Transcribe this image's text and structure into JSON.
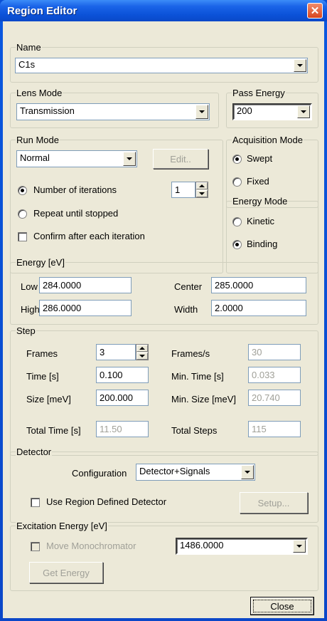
{
  "window": {
    "title": "Region Editor",
    "close_glyph": "✕"
  },
  "name_group": {
    "label": "Name",
    "value": "C1s"
  },
  "lens_mode": {
    "label": "Lens Mode",
    "value": "Transmission"
  },
  "pass_energy": {
    "label": "Pass Energy",
    "value": "200"
  },
  "run_mode": {
    "label": "Run Mode",
    "value": "Normal",
    "edit_button": "Edit..",
    "iterations_label": "Number of iterations",
    "iterations_value": "1",
    "repeat_label": "Repeat until stopped",
    "confirm_label": "Confirm after each iteration"
  },
  "acquisition_mode": {
    "label": "Acquisition Mode",
    "swept": "Swept",
    "fixed": "Fixed",
    "selected": "Swept"
  },
  "energy_mode": {
    "label": "Energy Mode",
    "kinetic": "Kinetic",
    "binding": "Binding",
    "selected": "Binding"
  },
  "energy": {
    "label": "Energy  [eV]",
    "low_label": "Low",
    "low_value": "284.0000",
    "high_label": "High",
    "high_value": "286.0000",
    "center_label": "Center",
    "center_value": "285.0000",
    "width_label": "Width",
    "width_value": "2.0000"
  },
  "step": {
    "label": "Step",
    "frames_label": "Frames",
    "frames_value": "3",
    "time_label": "Time [s]",
    "time_value": "0.100",
    "size_label": "Size [meV]",
    "size_value": "200.000",
    "total_time_label": "Total Time [s]",
    "total_time_value": "11.50",
    "fps_label": "Frames/s",
    "fps_value": "30",
    "min_time_label": "Min. Time [s]",
    "min_time_value": "0.033",
    "min_size_label": "Min. Size [meV]",
    "min_size_value": "20.740",
    "total_steps_label": "Total Steps",
    "total_steps_value": "115"
  },
  "detector": {
    "label": "Detector",
    "config_label": "Configuration",
    "config_value": "Detector+Signals",
    "use_region_label": "Use Region Defined Detector",
    "setup_button": "Setup..."
  },
  "excitation": {
    "label": "Excitation Energy [eV]",
    "move_mono_label": "Move Monochromator",
    "value": "1486.0000",
    "get_energy_button": "Get Energy"
  },
  "footer": {
    "close_button": "Close"
  }
}
